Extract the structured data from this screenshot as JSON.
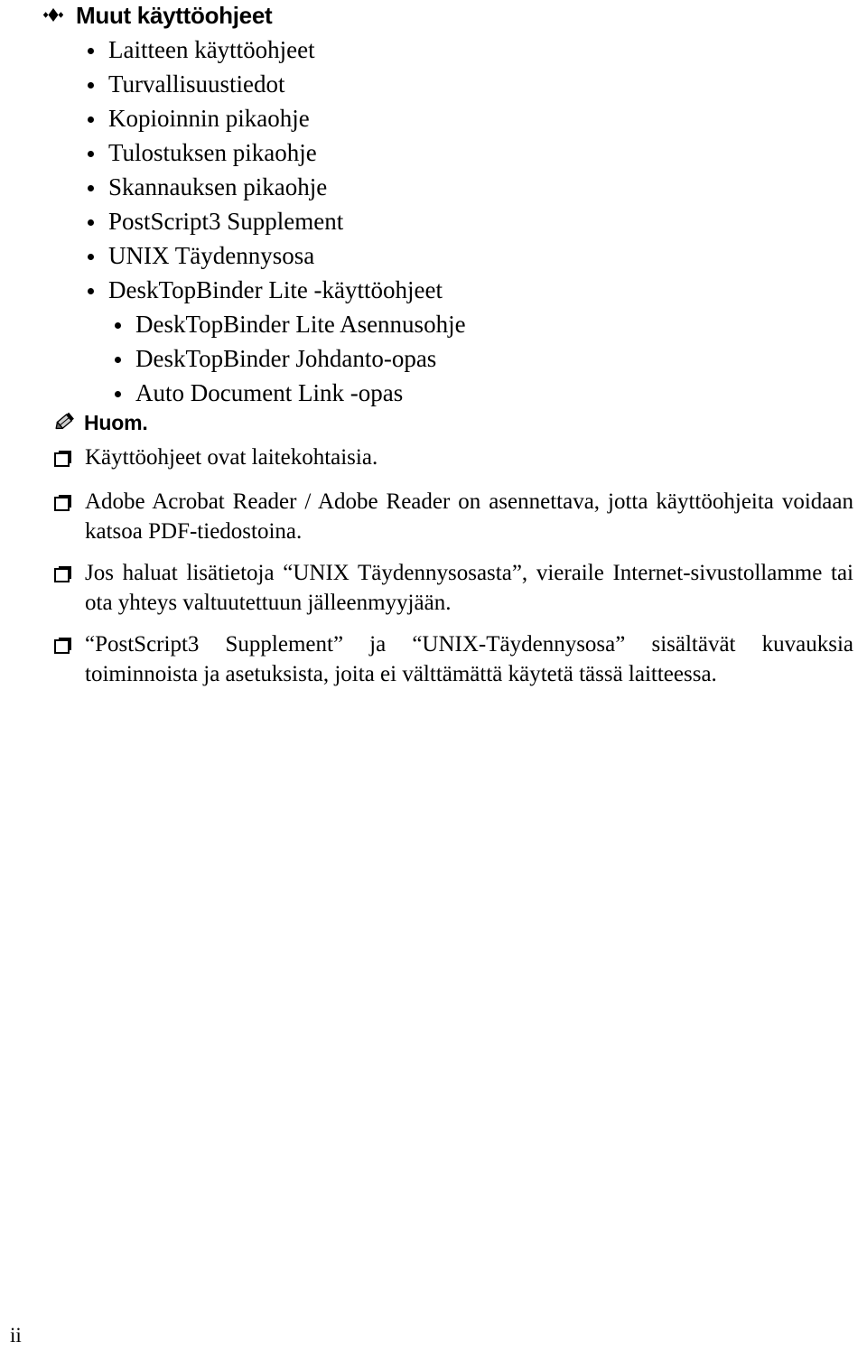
{
  "page": {
    "language": "fi",
    "background_color": "#ffffff",
    "text_color": "#000000",
    "folio": "ii"
  },
  "section": {
    "icon": "diamond-bullet-icon",
    "heading": "Muut käyttöohjeet",
    "items": [
      {
        "label": "Laitteen käyttöohjeet",
        "level": 1
      },
      {
        "label": "Turvallisuustiedot",
        "level": 1
      },
      {
        "label": "Kopioinnin pikaohje",
        "level": 1
      },
      {
        "label": "Tulostuksen pikaohje",
        "level": 1
      },
      {
        "label": "Skannauksen pikaohje",
        "level": 1
      },
      {
        "label": "PostScript3 Supplement",
        "level": 1
      },
      {
        "label": "UNIX Täydennysosa",
        "level": 1
      },
      {
        "label": "DeskTopBinder Lite -käyttöohjeet",
        "level": 1
      },
      {
        "label": "DeskTopBinder Lite Asennusohje",
        "level": 2
      },
      {
        "label": "DeskTopBinder Johdanto-opas",
        "level": 2
      },
      {
        "label": "Auto Document Link -opas",
        "level": 2
      }
    ]
  },
  "note": {
    "icon": "pencil-icon",
    "title": "Huom.",
    "bullet_icon": "shadowed-box-bullet-icon",
    "items": [
      "Käyttöohjeet ovat laitekohtaisia.",
      "Adobe Acrobat Reader / Adobe Reader on asennettava, jotta käyttöohjeita voidaan katsoa PDF-tiedostoina.",
      "Jos haluat lisätietoja “UNIX Täydennysosasta”, vieraile Internet-sivustollamme tai ota yhteys valtuutettuun jälleenmyyjään.",
      "“PostScript3 Supplement” ja “UNIX-Täydennysosa” sisältävät kuvauksia toiminnoista ja asetuksista, joita ei välttämättä käytetä tässä laitteessa."
    ]
  }
}
